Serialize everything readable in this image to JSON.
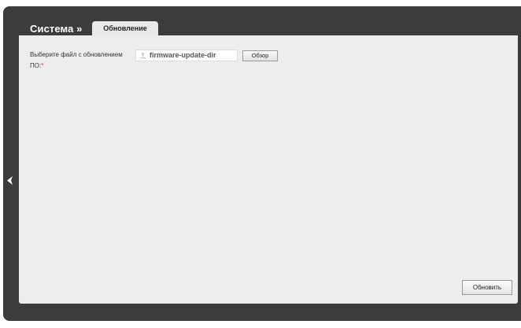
{
  "header": {
    "section_title": "Система »",
    "active_tab": "Обновление"
  },
  "form": {
    "file_label": "Выберите файл с обновлением ПО:",
    "required_mark": "*",
    "file_value": "firmware-update-dir",
    "browse_label": "Обзор",
    "submit_label": "Обновить"
  },
  "icons": {
    "collapse": "chevron-left-icon",
    "upload": "upload-icon"
  },
  "colors": {
    "frame": "#3c3c3c",
    "panel": "#ededed",
    "required": "#e03a2f"
  }
}
